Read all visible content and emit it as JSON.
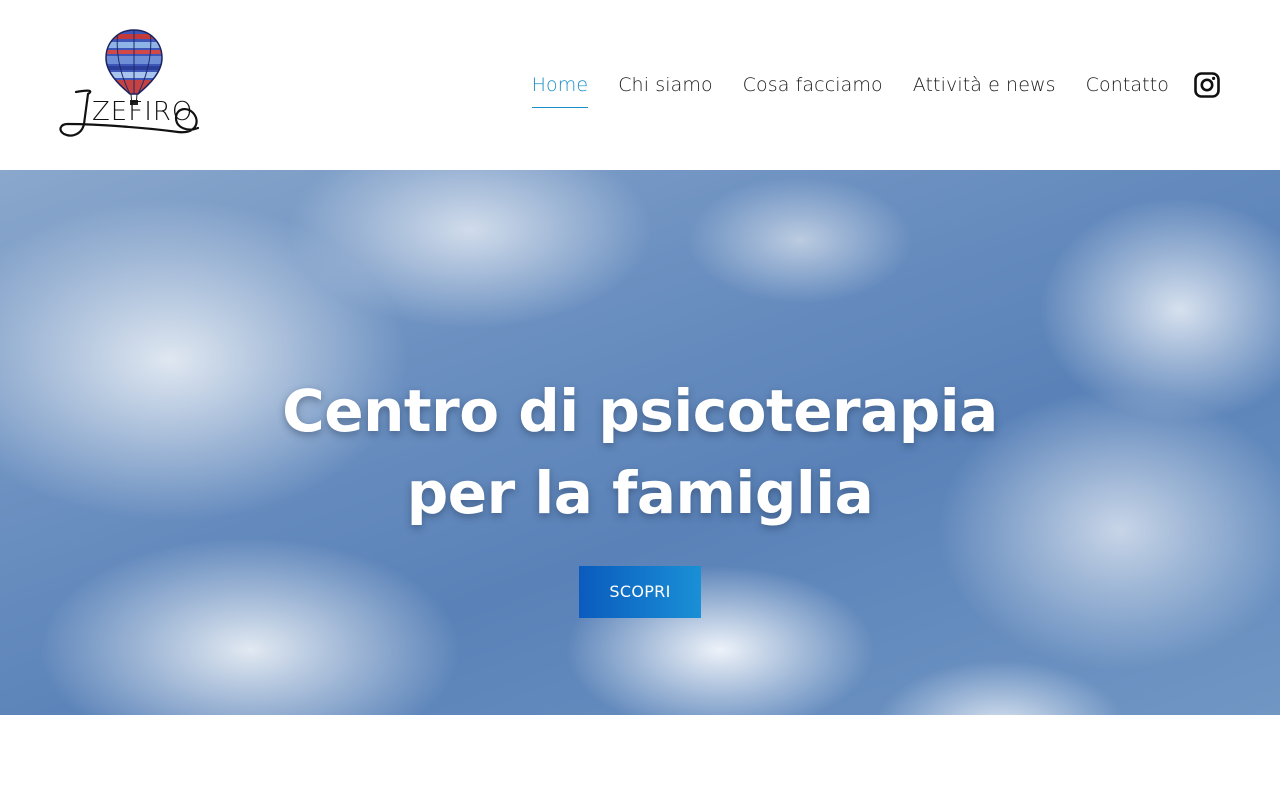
{
  "brand": {
    "logo_text": "ZEFIRO",
    "logo_icon": "hot-air-balloon-icon"
  },
  "nav": {
    "items": [
      {
        "label": "Home",
        "active": true
      },
      {
        "label": "Chi siamo",
        "active": false
      },
      {
        "label": "Cosa facciamo",
        "active": false
      },
      {
        "label": "Attività e news",
        "active": false
      },
      {
        "label": "Contatto",
        "active": false
      }
    ],
    "social_icon": "instagram-icon"
  },
  "hero": {
    "title_line1": "Centro di psicoterapia",
    "title_line2": "per la famiglia",
    "cta_label": "SCOPRI",
    "background": "sky-with-clouds"
  },
  "colors": {
    "accent": "#1a8fc6",
    "button_start": "#0a5bbd",
    "button_end": "#1a90d6",
    "text": "#1a1a1a"
  }
}
